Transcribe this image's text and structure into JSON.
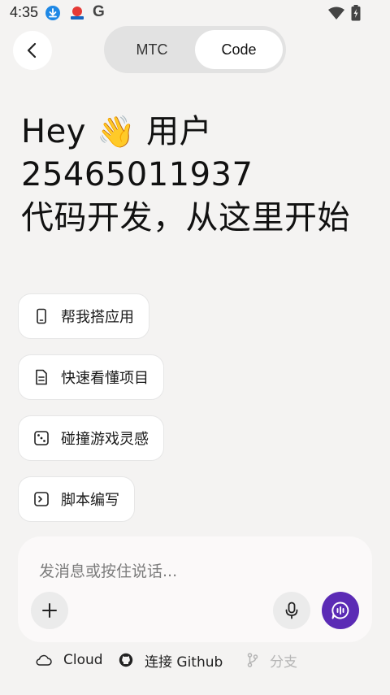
{
  "status_bar": {
    "time": "4:35",
    "icons": [
      "download-icon",
      "app-notification-icon",
      "google-icon",
      "wifi-icon",
      "battery-charging-icon"
    ]
  },
  "header": {
    "back_icon": "chevron-left-icon",
    "tabs": [
      {
        "label": "MTC",
        "selected": false
      },
      {
        "label": "Code",
        "selected": true
      }
    ]
  },
  "greeting": {
    "hey": "Hey",
    "emoji": "👋",
    "name_prefix": "用户",
    "user_id": "25465011937",
    "subtitle": "代码开发，从这里开始"
  },
  "suggestions": [
    {
      "label": "帮我搭应用",
      "icon": "phone-icon"
    },
    {
      "label": "快速看懂项目",
      "icon": "document-icon"
    },
    {
      "label": "碰撞游戏灵感",
      "icon": "dice-icon"
    },
    {
      "label": "脚本编写",
      "icon": "terminal-icon"
    }
  ],
  "composer": {
    "placeholder": "发消息或按住说话...",
    "add_icon": "plus-icon",
    "mic_icon": "microphone-icon",
    "send_icon": "voice-chat-icon",
    "accent_color": "#5b2bb5"
  },
  "bottom_bar": {
    "cloud_label": "Cloud",
    "github_label": "连接 Github",
    "branch_label": "分支"
  }
}
